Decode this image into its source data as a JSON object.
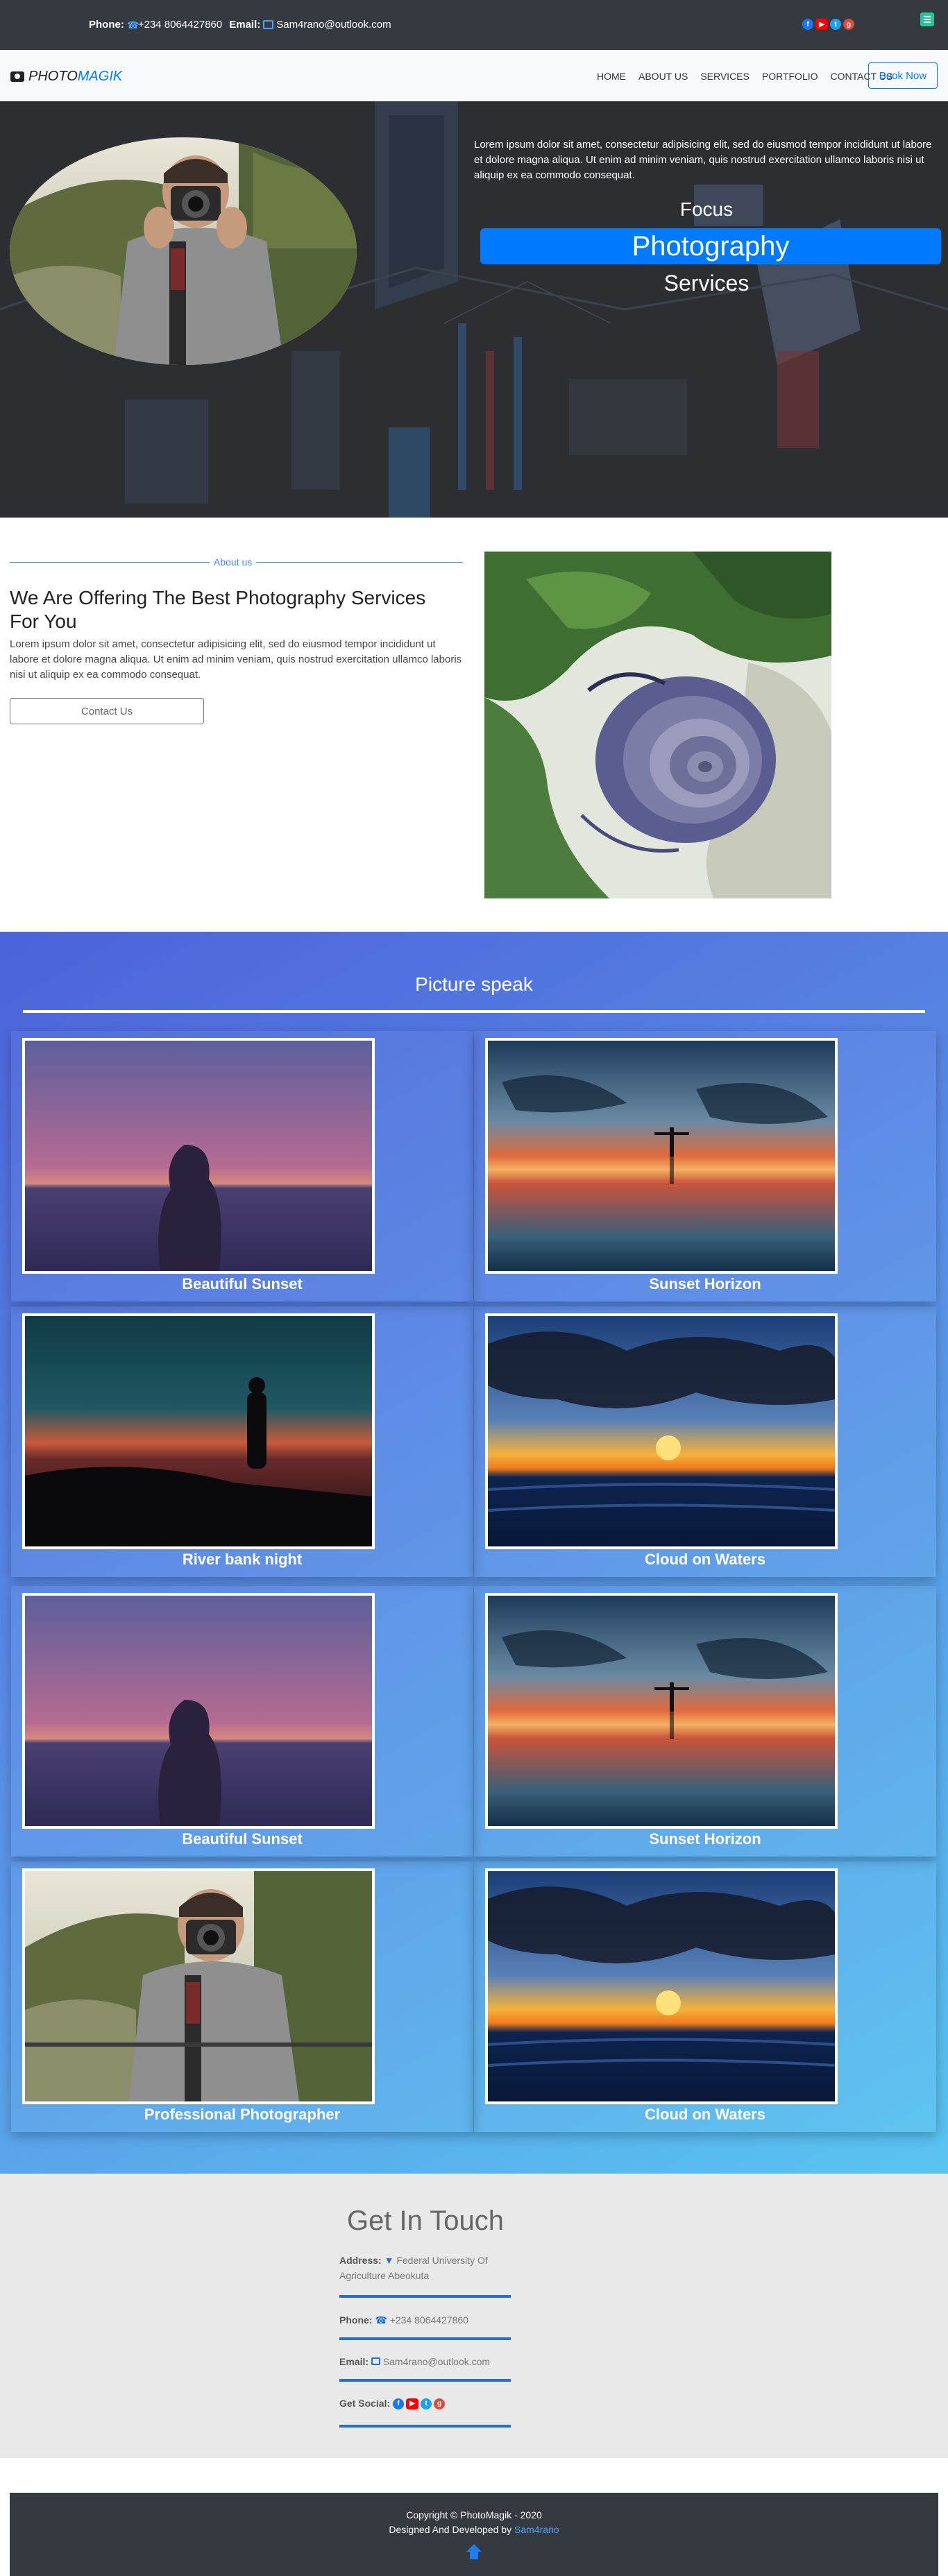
{
  "topbar": {
    "phone_label": "Phone:",
    "phone_value": "+234 8064427860",
    "email_label": "Email:",
    "email_value": "Sam4rano@outlook.com",
    "socials": [
      "facebook-icon",
      "youtube-icon",
      "twitter-icon",
      "google-plus-icon"
    ]
  },
  "navbar": {
    "brand_part1": "PHOTO",
    "brand_part2": "MAGIK",
    "links": [
      "HOME",
      "ABOUT US",
      "SERVICES",
      "PORTFOLIO",
      "CONTACT US"
    ],
    "cta": "Book Now"
  },
  "hero": {
    "text": "Lorem ipsum dolor sit amet, consectetur adipisicing elit, sed do eiusmod tempor incididunt ut labore et dolore magna aliqua. Ut enim ad minim veniam, quis nostrud exercitation ullamco laboris nisi ut aliquip ex ea commodo consequat.",
    "focus": "Focus",
    "photography": "Photography",
    "services": "Services"
  },
  "about": {
    "label": "About us",
    "title": "We Are Offering The Best Photography Services For You",
    "body": "Lorem ipsum dolor sit amet, consectetur adipisicing elit, sed do eiusmod tempor incididunt ut labore et dolore magna aliqua. Ut enim ad minim veniam, quis nostrud exercitation ullamco laboris nisi ut aliquip ex ea commodo consequat.",
    "button": "Contact Us"
  },
  "gallery": {
    "title": "Picture speak",
    "cards": [
      {
        "caption": "Beautiful Sunset"
      },
      {
        "caption": "Sunset Horizon"
      },
      {
        "caption": "River bank night"
      },
      {
        "caption": "Cloud on Waters"
      },
      {
        "caption": "Beautiful Sunset"
      },
      {
        "caption": "Sunset Horizon"
      },
      {
        "caption": "Professional Photographer"
      },
      {
        "caption": "Cloud on Waters"
      }
    ]
  },
  "touch": {
    "title": "Get In Touch",
    "address_label": "Address:",
    "address_value": "Federal University Of Agriculture Abeokuta",
    "phone_label": "Phone:",
    "phone_value": "+234 8064427860",
    "email_label": "Email:",
    "email_value": "Sam4rano@outlook.com",
    "social_label": "Get Social:"
  },
  "footer": {
    "copyright": "Copyright © PhotoMagik - 2020",
    "designed": "Designed And Developed by",
    "developer": "Sam4rano"
  },
  "colors": {
    "accent": "#007bff",
    "dark": "#343a40",
    "gallery_start": "#4c63d9",
    "gallery_end": "#59c4f0"
  }
}
